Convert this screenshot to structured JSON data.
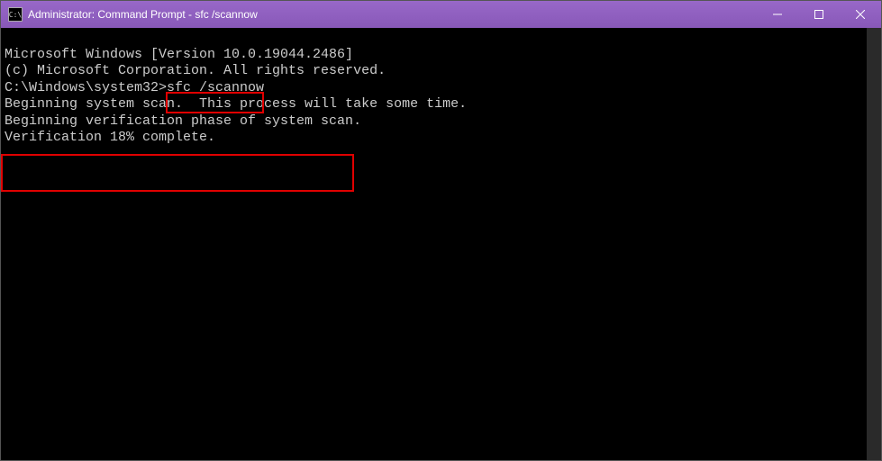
{
  "titlebar": {
    "icon_label": "C:\\",
    "title": "Administrator: Command Prompt - sfc  /scannow"
  },
  "terminal": {
    "line1": "Microsoft Windows [Version 10.0.19044.2486]",
    "line2": "(c) Microsoft Corporation. All rights reserved.",
    "blank1": "",
    "prompt": "C:\\Windows\\system32>",
    "command": "sfc /scannow",
    "blank2": "",
    "line3": "Beginning system scan.  This process will take some time.",
    "blank3": "",
    "line4": "Beginning verification phase of system scan.",
    "line5": "Verification 18% complete."
  }
}
